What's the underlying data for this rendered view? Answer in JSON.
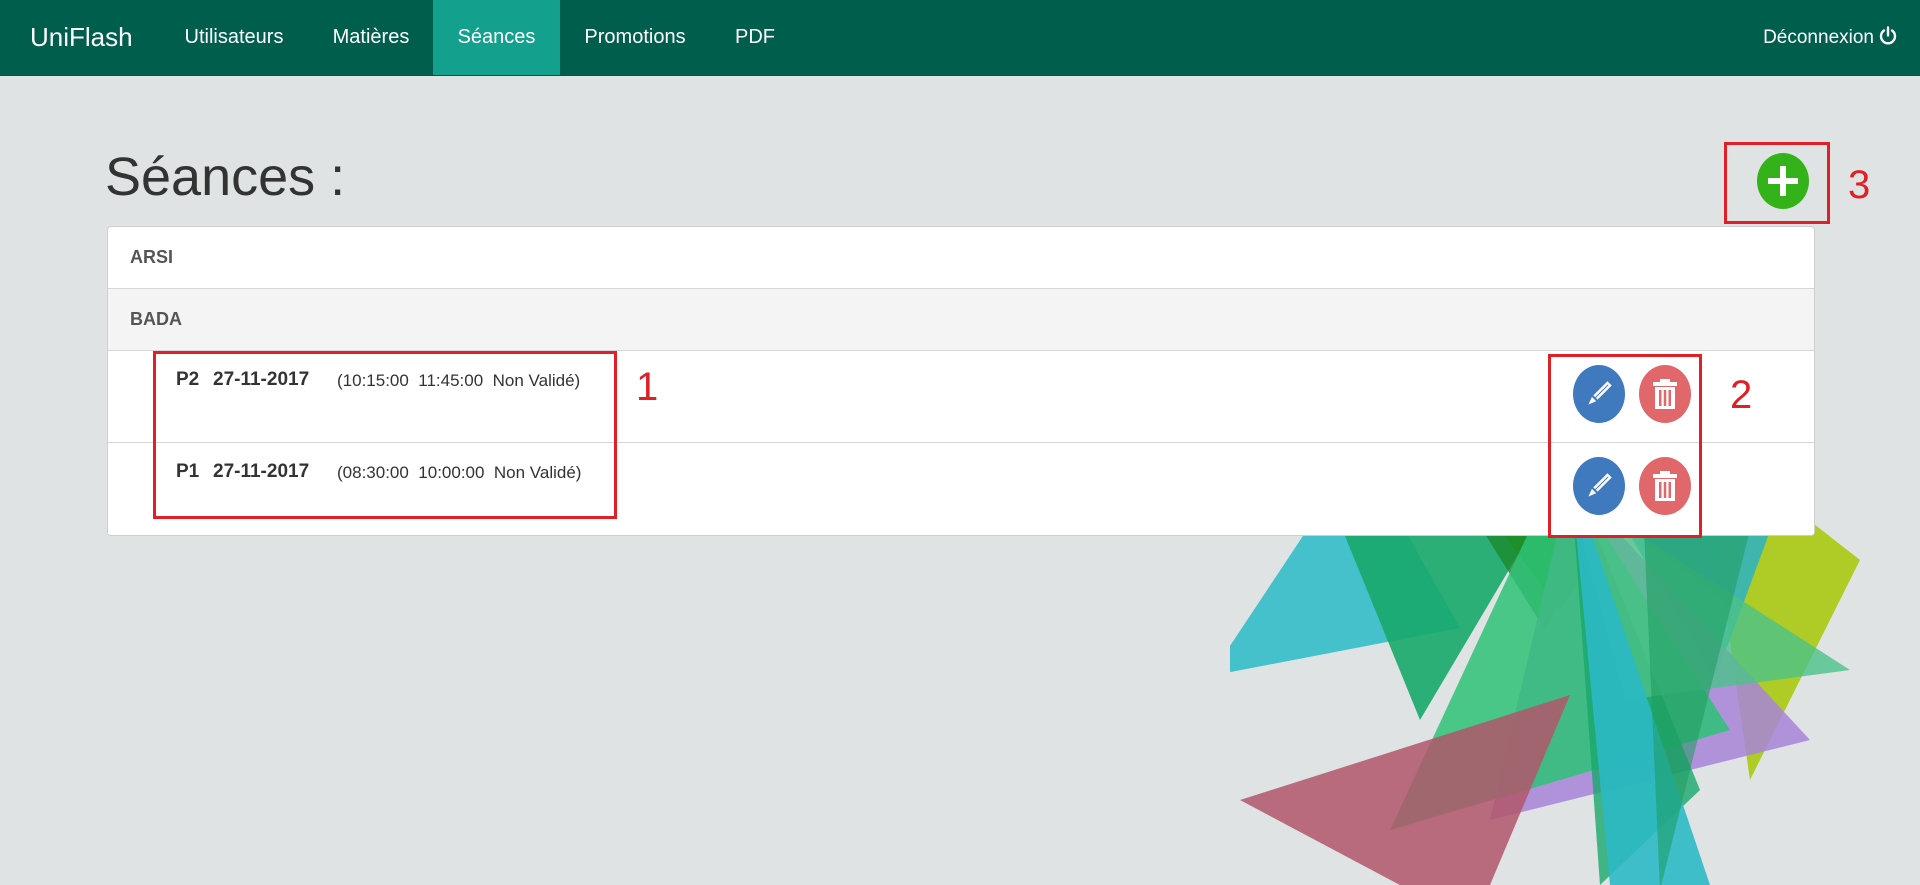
{
  "navbar": {
    "brand": "UniFlash",
    "items": [
      {
        "label": "Utilisateurs",
        "active": false
      },
      {
        "label": "Matières",
        "active": false
      },
      {
        "label": "Séances",
        "active": true
      },
      {
        "label": "Promotions",
        "active": false
      },
      {
        "label": "PDF",
        "active": false
      }
    ],
    "logout_label": "Déconnexion"
  },
  "page": {
    "title": "Séances :"
  },
  "groups": [
    {
      "name": "ARSI"
    },
    {
      "name": "BADA"
    }
  ],
  "sessions": [
    {
      "code": "P2",
      "date": "27-11-2017",
      "details": "(10:15:00  11:45:00  Non Validé)"
    },
    {
      "code": "P1",
      "date": "27-11-2017",
      "details": "(08:30:00  10:00:00  Non Validé)"
    }
  ],
  "annotations": {
    "label_1": "1",
    "label_2": "2",
    "label_3": "3"
  },
  "colors": {
    "navbar": "#005e4d",
    "nav_active": "#13a08c",
    "add_button": "#34b21a",
    "edit_button": "#3f7abe",
    "delete_button": "#e0686b",
    "annotation": "#e11f26"
  }
}
